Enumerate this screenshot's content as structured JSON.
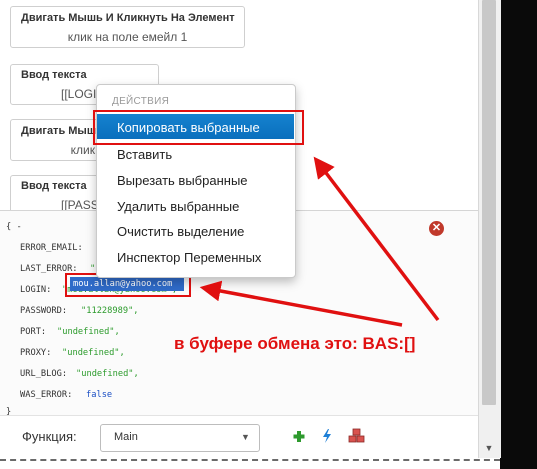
{
  "actions": [
    {
      "title": "Двигать Мышь И Кликнуть На Элемент",
      "sub": "клик на поле емейл 1"
    },
    {
      "title": "Ввод текста",
      "sub": "[[LOGIN]]"
    },
    {
      "title": "Двигать Мышь И Кликнуть На Элемент",
      "sub": "клик на поле пароль"
    },
    {
      "title": "Ввод текста",
      "sub": "[[PASSWORD]]"
    }
  ],
  "variables": {
    "open": "{ -",
    "close": "}",
    "lines": [
      {
        "key": "ERROR_EMAIL:",
        "value": "\"\","
      },
      {
        "key": "LAST_ERROR:",
        "value": "\"\","
      },
      {
        "key": "LOGIN:",
        "value": "\"mou.allan@yahoo.com\","
      },
      {
        "key": "PASSWORD:",
        "value": "\"11228989\","
      },
      {
        "key": "PORT:",
        "value": "\"undefined\","
      },
      {
        "key": "PROXY:",
        "value": "\"undefined\","
      },
      {
        "key": "URL_BLOG:",
        "value": "\"undefined\","
      },
      {
        "key": "WAS_ERROR:",
        "value": "false"
      }
    ],
    "selected_login": "mou.allan@yahoo.com"
  },
  "context_menu": {
    "header": "ДЕЙСТВИЯ",
    "items": [
      "Копировать выбранные",
      "Вставить",
      "Вырезать выбранные",
      "Удалить выбранные",
      "Очистить выделение",
      "Инспектор Переменных"
    ],
    "highlighted_index": 0
  },
  "function_bar": {
    "label": "Функция:",
    "selected": "Main",
    "add_icon": "plus-icon",
    "run_icon": "lightning-icon",
    "modules_icon": "cubes-icon"
  },
  "annotation": {
    "text": "в буфере обмена это: BAS:[]",
    "color": "#e01010"
  },
  "colors": {
    "menu_highlight": "#0a6fbd",
    "string_value": "#2c9b2c",
    "keyword_value": "#1b4fc4"
  }
}
